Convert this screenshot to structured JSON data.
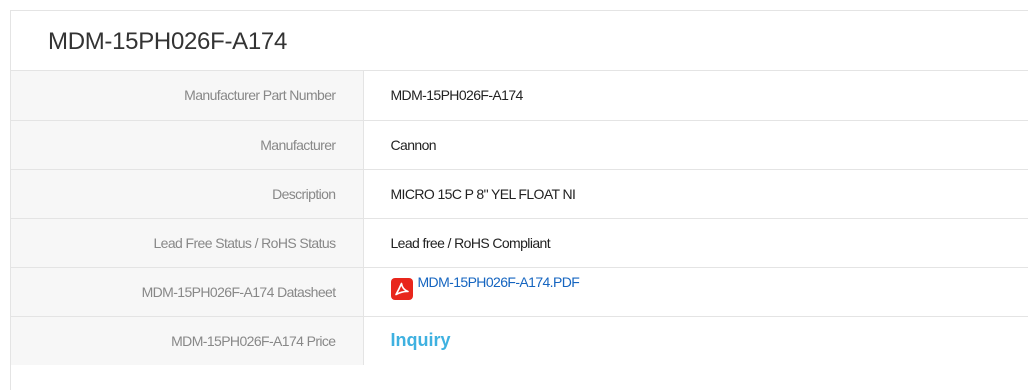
{
  "product": {
    "title": "MDM-15PH026F-A174"
  },
  "spec_rows": [
    {
      "label": "Manufacturer Part Number",
      "value": "MDM-15PH026F-A174"
    },
    {
      "label": "Manufacturer",
      "value": "Cannon"
    },
    {
      "label": "Description",
      "value": "MICRO 15C P 8\" YEL FLOAT NI"
    },
    {
      "label": "Lead Free Status / RoHS Status",
      "value": "Lead free / RoHS Compliant"
    },
    {
      "label": "MDM-15PH026F-A174 Datasheet",
      "value": "MDM-15PH026F-A174.PDF",
      "icon": "pdf-icon"
    },
    {
      "label": "MDM-15PH026F-A174 Price",
      "value": "Inquiry"
    }
  ],
  "colors": {
    "border": "#e4e4e4",
    "label_bg": "#f7f7f7",
    "label_text": "#888888",
    "link": "#1565c0",
    "inquiry": "#3fb1e0",
    "pdf_red": "#e8261c"
  }
}
